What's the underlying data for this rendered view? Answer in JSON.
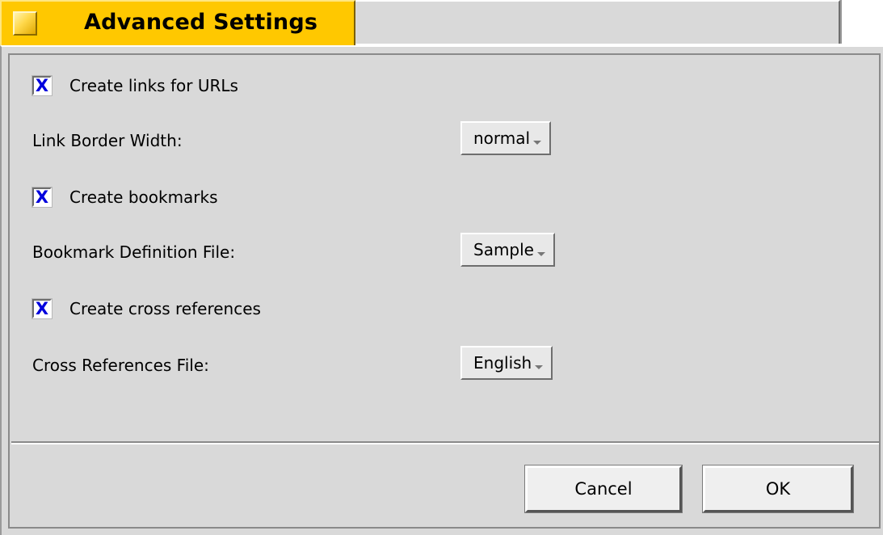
{
  "window": {
    "tab_title": "Advanced Settings",
    "tab_icon": "window-menu-icon",
    "accent_color": "#ffc800",
    "panel_color": "#d9d9d9"
  },
  "options": {
    "create_links": {
      "label": "Create links for URLs",
      "checked": true,
      "check_mark": "X"
    },
    "link_border_width": {
      "label": "Link Border Width:",
      "value": "normal"
    },
    "create_bookmarks": {
      "label": "Create bookmarks",
      "checked": true,
      "check_mark": "X"
    },
    "bookmark_definition_file": {
      "label": "Bookmark Definition File:",
      "value": "Sample"
    },
    "create_cross_references": {
      "label": "Create cross references",
      "checked": true,
      "check_mark": "X"
    },
    "cross_references_file": {
      "label": "Cross References File:",
      "value": "English"
    }
  },
  "buttons": {
    "cancel": "Cancel",
    "ok": "OK"
  }
}
